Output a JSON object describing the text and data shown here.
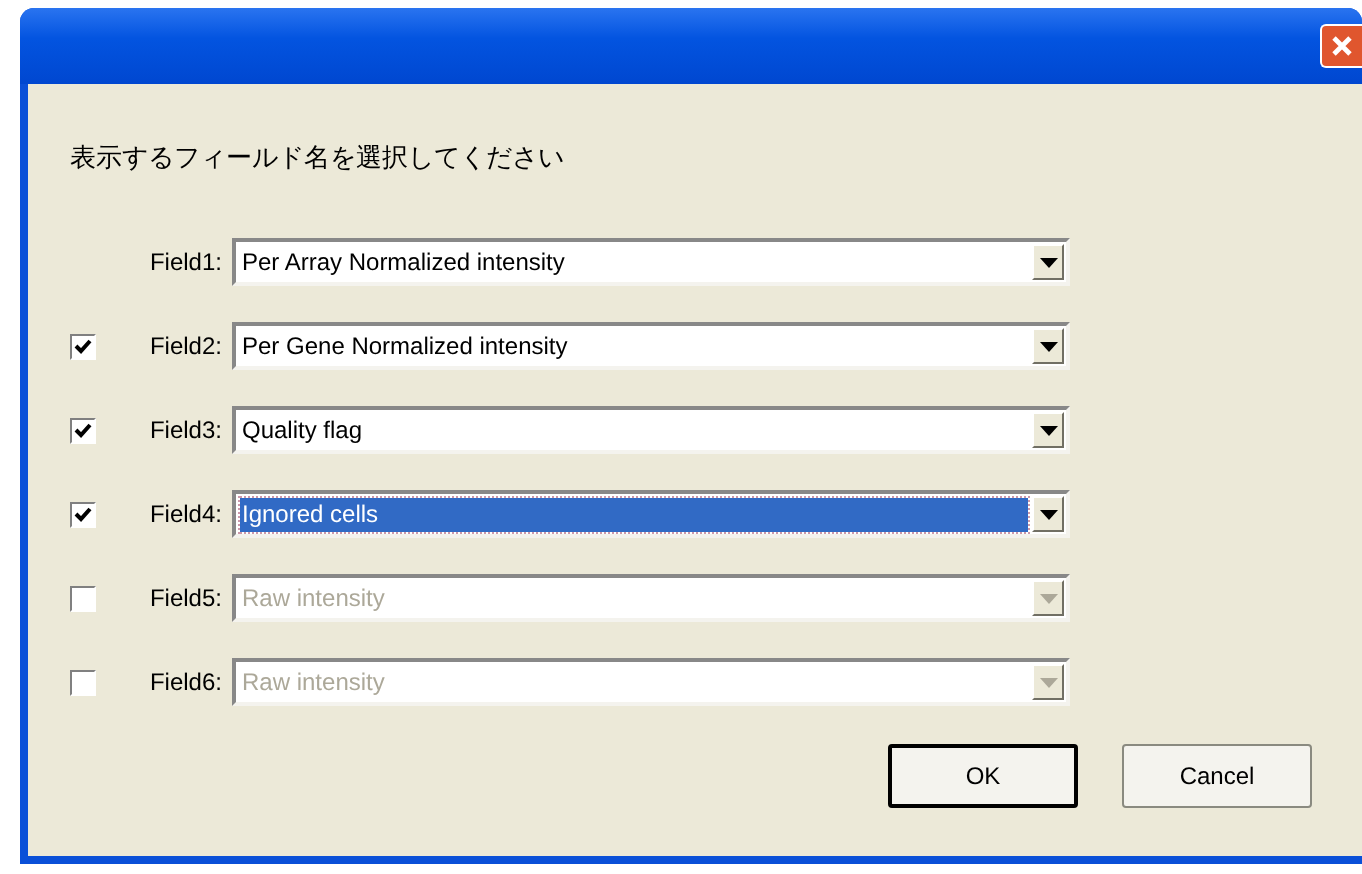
{
  "prompt": "表示するフィールド名を選択してください",
  "fields": [
    {
      "label": "Field1:",
      "value": "Per Array Normalized intensity",
      "disabled": false,
      "selected": false
    },
    {
      "label": "Field2:",
      "checked": true,
      "value": "Per Gene Normalized intensity",
      "disabled": false,
      "selected": false
    },
    {
      "label": "Field3:",
      "checked": true,
      "value": "Quality flag",
      "disabled": false,
      "selected": false
    },
    {
      "label": "Field4:",
      "checked": true,
      "value": "Ignored cells",
      "disabled": false,
      "selected": true
    },
    {
      "label": "Field5:",
      "checked": false,
      "value": "Raw intensity",
      "disabled": true,
      "selected": false
    },
    {
      "label": "Field6:",
      "checked": false,
      "value": "Raw intensity",
      "disabled": true,
      "selected": false
    }
  ],
  "buttons": [
    {
      "label": "OK",
      "default": true
    },
    {
      "label": "Cancel",
      "default": false
    }
  ]
}
